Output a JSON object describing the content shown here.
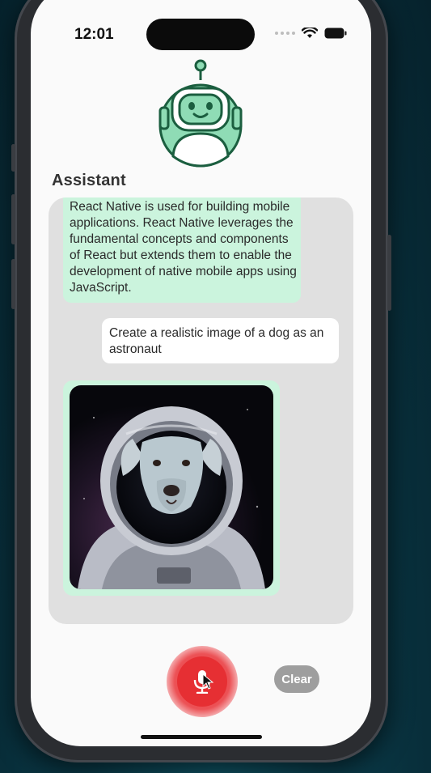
{
  "status_bar": {
    "time": "12:01"
  },
  "header": {
    "title": "Assistant"
  },
  "chat": {
    "messages": [
      {
        "role": "assistant",
        "text": "React Native is used for building mobile applications. React Native leverages the fundamental concepts and components of React but extends them to enable the development of native mobile apps using JavaScript."
      },
      {
        "role": "user",
        "text": "Create a realistic image of a dog as an astronaut"
      },
      {
        "role": "assistant",
        "type": "image",
        "icon": "dog-astronaut-image"
      }
    ]
  },
  "controls": {
    "clear_label": "Clear",
    "mic_icon": "microphone-icon"
  },
  "colors": {
    "assistant_bubble": "#cbf4dd",
    "user_bubble": "#ffffff",
    "chat_background": "#e0e0e0",
    "mic_red": "#e62f33",
    "clear_gray": "#9e9e9e",
    "robot_green": "#8fdcb5"
  }
}
